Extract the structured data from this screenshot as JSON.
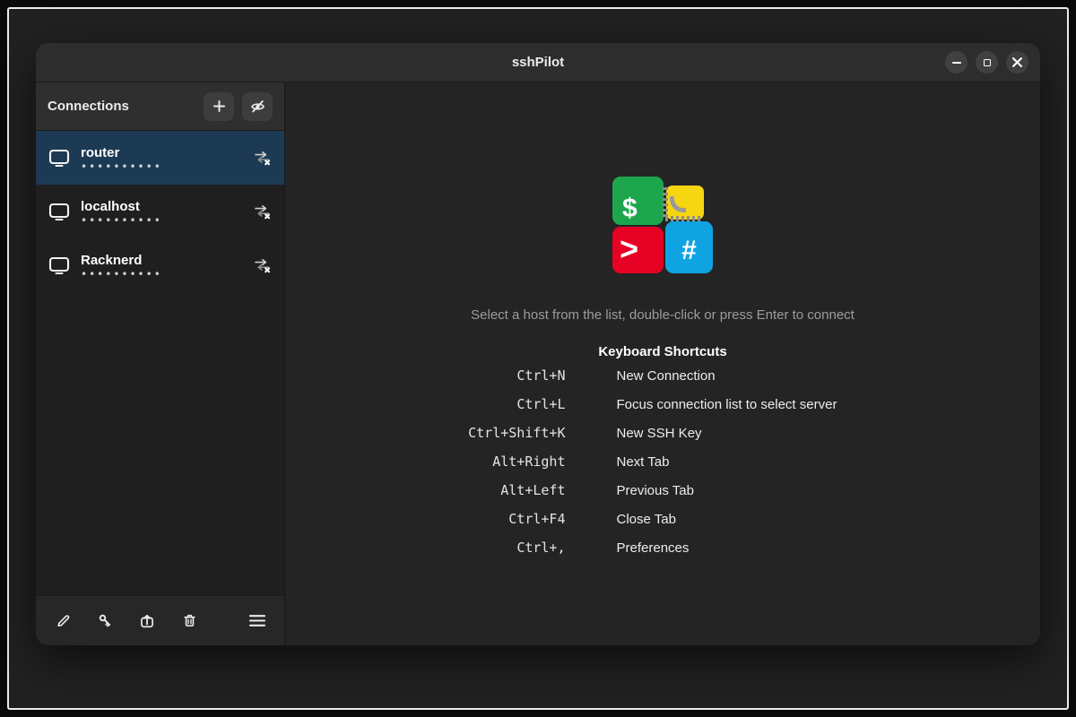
{
  "window": {
    "title": "sshPilot",
    "controls": [
      {
        "name": "minimize"
      },
      {
        "name": "maximize"
      },
      {
        "name": "close"
      }
    ]
  },
  "sidebar": {
    "header_label": "Connections",
    "header_buttons": [
      {
        "name": "add-connection",
        "icon": "plus-icon"
      },
      {
        "name": "toggle-password-visibility",
        "icon": "eye-off-icon"
      }
    ],
    "connections": [
      {
        "name": "router",
        "dots": "••••••••••",
        "selected": true,
        "status_icon": "disconnected-icon"
      },
      {
        "name": "localhost",
        "dots": "••••••••••",
        "selected": false,
        "status_icon": "disconnected-icon"
      },
      {
        "name": "Racknerd",
        "dots": "••••••••••",
        "selected": false,
        "status_icon": "disconnected-icon"
      }
    ],
    "toolbar_icons": [
      "pencil-icon",
      "key-icon",
      "upload-server-icon",
      "trash-icon",
      "menu-icon"
    ]
  },
  "main": {
    "logo_glyphs": {
      "dollar": "$",
      "prompt": ">",
      "hash": "#"
    },
    "hint": "Select a host from the list, double-click or press Enter to connect",
    "shortcuts_title": "Keyboard Shortcuts",
    "shortcuts": [
      {
        "keys": "Ctrl+N",
        "action": "New Connection"
      },
      {
        "keys": "Ctrl+L",
        "action": "Focus connection list to select server"
      },
      {
        "keys": "Ctrl+Shift+K",
        "action": "New SSH Key"
      },
      {
        "keys": "Alt+Right",
        "action": "Next Tab"
      },
      {
        "keys": "Alt+Left",
        "action": "Previous Tab"
      },
      {
        "keys": "Ctrl+F4",
        "action": "Close Tab"
      },
      {
        "keys": "Ctrl+,",
        "action": "Preferences"
      }
    ]
  },
  "colors": {
    "titlebar_bg": "#2d2d2d",
    "sidebar_bg": "#1f1f1f",
    "main_bg": "#242424",
    "selection_bg": "#1d3a55",
    "logo_green": "#1ea64e",
    "logo_yellow": "#f6d511",
    "logo_red": "#e60023",
    "logo_blue": "#10a3e1"
  }
}
